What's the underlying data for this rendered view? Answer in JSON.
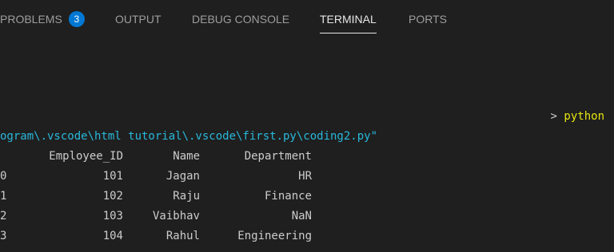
{
  "tabs": [
    {
      "label": "PROBLEMS",
      "badge": "3"
    },
    {
      "label": "OUTPUT"
    },
    {
      "label": "DEBUG CONSOLE"
    },
    {
      "label": "TERMINAL",
      "active": true
    },
    {
      "label": "PORTS"
    }
  ],
  "terminal": {
    "prompt_arrow": ">",
    "prompt_cmd": "python",
    "path_line": "ogram\\.vscode\\html tutorial\\.vscode\\first.py\\coding2.py\"",
    "table": {
      "headers": [
        "Employee_ID",
        "Name",
        "Department"
      ],
      "rows": [
        {
          "index": "0",
          "id": "101",
          "name": "Jagan",
          "dept": "HR"
        },
        {
          "index": "1",
          "id": "102",
          "name": "Raju",
          "dept": "Finance"
        },
        {
          "index": "2",
          "id": "103",
          "name": "Vaibhav",
          "dept": "NaN"
        },
        {
          "index": "3",
          "id": "104",
          "name": "Rahul",
          "dept": "Engineering"
        }
      ]
    }
  },
  "colors": {
    "background": "#1f1f1f",
    "badge": "#0078d4",
    "path": "#29b8db",
    "prompt": "#e5e510",
    "text": "#cccccc"
  }
}
